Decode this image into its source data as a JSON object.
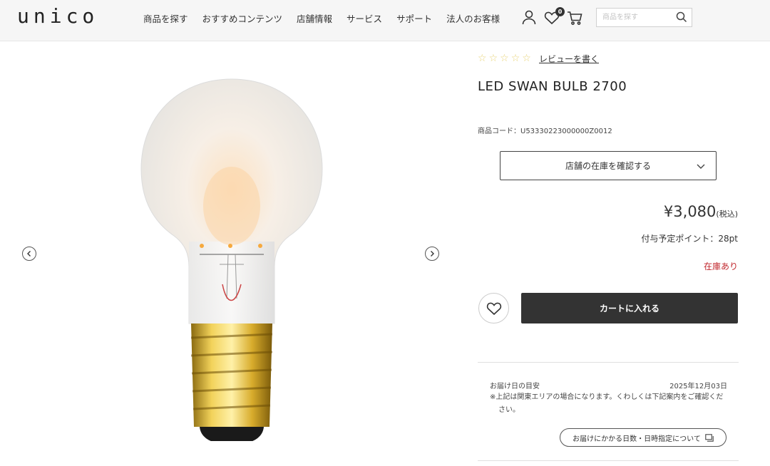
{
  "header": {
    "logo": "unico",
    "nav": [
      "商品を探す",
      "おすすめコンテンツ",
      "店舗情報",
      "サービス",
      "サポート",
      "法人のお客様"
    ],
    "favorites_count": "0",
    "search_placeholder": "商品を探す"
  },
  "product": {
    "review_link": "レビューを書く",
    "rating_stars": 0,
    "title": "LED SWAN BULB 2700",
    "code": "商品コード：U53330223000000Z0012",
    "stock_dropdown": "店舗の在庫を確認する",
    "price": "¥3,080",
    "tax_label": "(税込)",
    "points": "付与予定ポイント：28pt",
    "availability": "在庫あり",
    "cart_button": "カートに入れる"
  },
  "delivery": {
    "label": "お届け日の目安",
    "date": "2025年12月03日",
    "note": "※上記は関東エリアの場合になります。くわしくは下記案内をご確認ください。",
    "info_button": "お届けにかかる日数・日時指定について"
  },
  "colors": {
    "accent_dark": "#333333",
    "stock_red": "#c1272d",
    "star_empty": "#e8d47a"
  },
  "icons": [
    "user-icon",
    "heart-icon",
    "cart-icon",
    "search-icon",
    "chevron-left-icon",
    "chevron-right-icon",
    "chevron-down-icon",
    "window-icon"
  ]
}
